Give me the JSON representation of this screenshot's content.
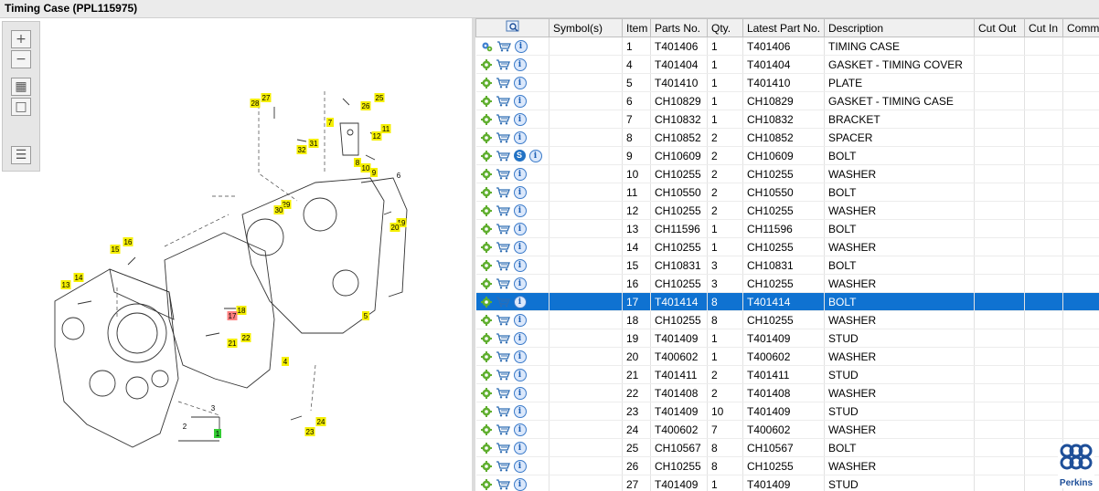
{
  "page_title": "Timing Case (PPL115975)",
  "brand": "Perkins",
  "colors": {
    "highlight": "#f5ef00",
    "highlight_selected": "#ff8080",
    "selection": "#0f72d1",
    "brand": "#1e4f99"
  },
  "toolbar": {
    "zoom_in_icon": "zoom-in-icon",
    "zoom_out_icon": "zoom-out-icon",
    "fit_icon": "fit-window-icon",
    "actual_size_icon": "actual-size-icon",
    "list_icon": "parts-list-export-icon"
  },
  "diagram": {
    "callouts": [
      {
        "label": "28",
        "hl": true
      },
      {
        "label": "27",
        "hl": true
      },
      {
        "label": "25",
        "hl": true
      },
      {
        "label": "26",
        "hl": true
      },
      {
        "label": "7",
        "hl": true
      },
      {
        "label": "11",
        "hl": true
      },
      {
        "label": "12",
        "hl": true
      },
      {
        "label": "31",
        "hl": true
      },
      {
        "label": "32",
        "hl": true
      },
      {
        "label": "8",
        "hl": true
      },
      {
        "label": "10",
        "hl": true
      },
      {
        "label": "9",
        "hl": true
      },
      {
        "label": "6",
        "hl": false
      },
      {
        "label": "29",
        "hl": true
      },
      {
        "label": "30",
        "hl": true
      },
      {
        "label": "19",
        "hl": true
      },
      {
        "label": "20",
        "hl": true
      },
      {
        "label": "16",
        "hl": true
      },
      {
        "label": "15",
        "hl": true
      },
      {
        "label": "14",
        "hl": true
      },
      {
        "label": "13",
        "hl": true
      },
      {
        "label": "18",
        "hl": true
      },
      {
        "label": "17",
        "hl": true,
        "selected": true
      },
      {
        "label": "22",
        "hl": true
      },
      {
        "label": "21",
        "hl": true
      },
      {
        "label": "5",
        "hl": true
      },
      {
        "label": "4",
        "hl": true
      },
      {
        "label": "3",
        "hl": false
      },
      {
        "label": "2",
        "hl": false
      },
      {
        "label": "1",
        "hl": true,
        "green": true
      },
      {
        "label": "24",
        "hl": true
      },
      {
        "label": "23",
        "hl": true
      }
    ]
  },
  "table": {
    "columns": [
      "",
      "Symbol(s)",
      "Item",
      "Parts No.",
      "Qty.",
      "Latest Part No.",
      "Description",
      "Cut Out",
      "Cut In",
      "Comment"
    ],
    "header_icon": "search-parts-icon",
    "selected_item": "17",
    "rows": [
      {
        "item": "1",
        "part": "T401406",
        "qty": "1",
        "latest": "T401406",
        "desc": "TIMING CASE",
        "first": true
      },
      {
        "item": "4",
        "part": "T401404",
        "qty": "1",
        "latest": "T401404",
        "desc": "GASKET - TIMING COVER"
      },
      {
        "item": "5",
        "part": "T401410",
        "qty": "1",
        "latest": "T401410",
        "desc": "PLATE"
      },
      {
        "item": "6",
        "part": "CH10829",
        "qty": "1",
        "latest": "CH10829",
        "desc": "GASKET - TIMING CASE"
      },
      {
        "item": "7",
        "part": "CH10832",
        "qty": "1",
        "latest": "CH10832",
        "desc": "BRACKET"
      },
      {
        "item": "8",
        "part": "CH10852",
        "qty": "2",
        "latest": "CH10852",
        "desc": "SPACER"
      },
      {
        "item": "9",
        "part": "CH10609",
        "qty": "2",
        "latest": "CH10609",
        "desc": "BOLT",
        "s": "S"
      },
      {
        "item": "10",
        "part": "CH10255",
        "qty": "2",
        "latest": "CH10255",
        "desc": "WASHER"
      },
      {
        "item": "11",
        "part": "CH10550",
        "qty": "2",
        "latest": "CH10550",
        "desc": "BOLT"
      },
      {
        "item": "12",
        "part": "CH10255",
        "qty": "2",
        "latest": "CH10255",
        "desc": "WASHER"
      },
      {
        "item": "13",
        "part": "CH11596",
        "qty": "1",
        "latest": "CH11596",
        "desc": "BOLT"
      },
      {
        "item": "14",
        "part": "CH10255",
        "qty": "1",
        "latest": "CH10255",
        "desc": "WASHER"
      },
      {
        "item": "15",
        "part": "CH10831",
        "qty": "3",
        "latest": "CH10831",
        "desc": "BOLT"
      },
      {
        "item": "16",
        "part": "CH10255",
        "qty": "3",
        "latest": "CH10255",
        "desc": "WASHER"
      },
      {
        "item": "17",
        "part": "T401414",
        "qty": "8",
        "latest": "T401414",
        "desc": "BOLT"
      },
      {
        "item": "18",
        "part": "CH10255",
        "qty": "8",
        "latest": "CH10255",
        "desc": "WASHER"
      },
      {
        "item": "19",
        "part": "T401409",
        "qty": "1",
        "latest": "T401409",
        "desc": "STUD"
      },
      {
        "item": "20",
        "part": "T400602",
        "qty": "1",
        "latest": "T400602",
        "desc": "WASHER"
      },
      {
        "item": "21",
        "part": "T401411",
        "qty": "2",
        "latest": "T401411",
        "desc": "STUD"
      },
      {
        "item": "22",
        "part": "T401408",
        "qty": "2",
        "latest": "T401408",
        "desc": "WASHER"
      },
      {
        "item": "23",
        "part": "T401409",
        "qty": "10",
        "latest": "T401409",
        "desc": "STUD"
      },
      {
        "item": "24",
        "part": "T400602",
        "qty": "7",
        "latest": "T400602",
        "desc": "WASHER"
      },
      {
        "item": "25",
        "part": "CH10567",
        "qty": "8",
        "latest": "CH10567",
        "desc": "BOLT"
      },
      {
        "item": "26",
        "part": "CH10255",
        "qty": "8",
        "latest": "CH10255",
        "desc": "WASHER"
      },
      {
        "item": "27",
        "part": "T401409",
        "qty": "1",
        "latest": "T401409",
        "desc": "STUD"
      }
    ]
  }
}
